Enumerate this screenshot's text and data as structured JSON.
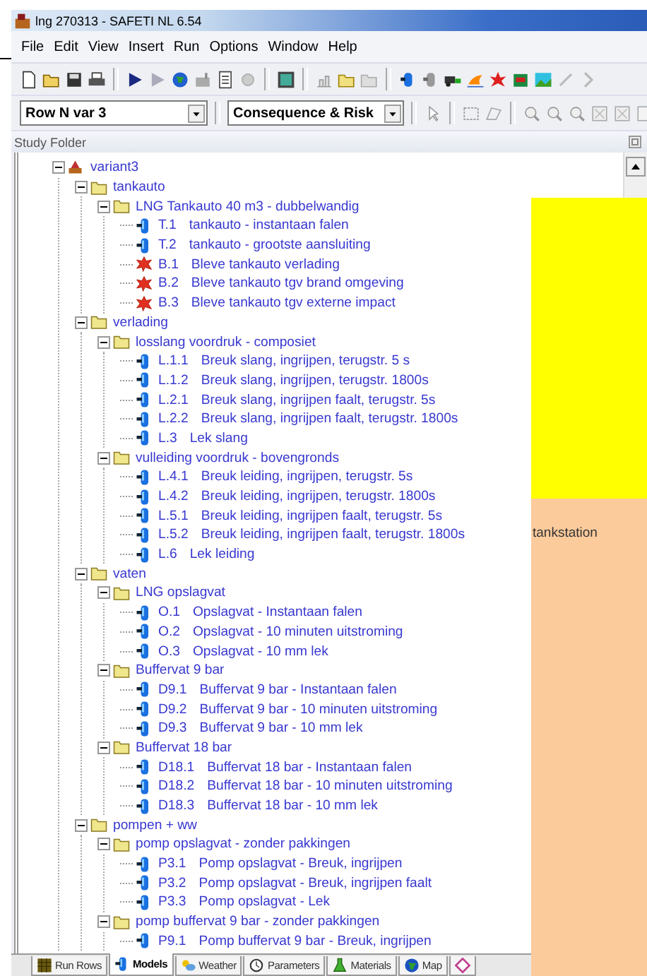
{
  "window": {
    "title": "lng 270313 - SAFETI NL 6.54"
  },
  "menu": [
    "File",
    "Edit",
    "View",
    "Insert",
    "Run",
    "Options",
    "Window",
    "Help"
  ],
  "selectors": [
    {
      "value": "Row N var 3"
    },
    {
      "value": "Consequence & Risk"
    }
  ],
  "panel": {
    "title": "Study Folder"
  },
  "tree": [
    {
      "kind": "study",
      "label": "variant3",
      "expanded": true,
      "children": [
        {
          "kind": "folder",
          "label": "tankauto",
          "expanded": true,
          "children": [
            {
              "kind": "folder",
              "label": "LNG Tankauto 40 m3 - dubbelwandig",
              "expanded": true,
              "children": [
                {
                  "kind": "release",
                  "code": "T.1",
                  "label": "tankauto - instantaan falen"
                },
                {
                  "kind": "release",
                  "code": "T.2",
                  "label": "tankauto - grootste aansluiting"
                },
                {
                  "kind": "bleve",
                  "code": "B.1",
                  "label": "Bleve tankauto verlading"
                },
                {
                  "kind": "bleve",
                  "code": "B.2",
                  "label": "Bleve tankauto tgv brand omgeving"
                },
                {
                  "kind": "bleve",
                  "code": "B.3",
                  "label": "Bleve tankauto tgv externe impact"
                }
              ]
            }
          ]
        },
        {
          "kind": "folder",
          "label": "verlading",
          "expanded": true,
          "children": [
            {
              "kind": "folder",
              "label": "losslang voordruk - composiet",
              "expanded": true,
              "children": [
                {
                  "kind": "release",
                  "code": "L.1.1",
                  "label": "Breuk slang, ingrijpen, terugstr. 5 s"
                },
                {
                  "kind": "release",
                  "code": "L.1.2",
                  "label": "Breuk slang, ingrijpen, terugstr. 1800s"
                },
                {
                  "kind": "release",
                  "code": "L.2.1",
                  "label": "Breuk slang, ingrijpen faalt, terugstr. 5s"
                },
                {
                  "kind": "release",
                  "code": "L.2.2",
                  "label": "Breuk slang, ingrijpen faalt, terugstr. 1800s"
                },
                {
                  "kind": "release",
                  "code": "L.3",
                  "label": "Lek slang"
                }
              ]
            },
            {
              "kind": "folder",
              "label": "vulleiding voordruk - bovengronds",
              "expanded": true,
              "children": [
                {
                  "kind": "release",
                  "code": "L.4.1",
                  "label": "Breuk leiding, ingrijpen, terugstr. 5s"
                },
                {
                  "kind": "release",
                  "code": "L.4.2",
                  "label": "Breuk leiding, ingrijpen, terugstr. 1800s"
                },
                {
                  "kind": "release",
                  "code": "L.5.1",
                  "label": "Breuk leiding, ingrijpen faalt, terugstr. 5s"
                },
                {
                  "kind": "release",
                  "code": "L.5.2",
                  "label": "Breuk leiding, ingrijpen faalt, terugstr. 1800s"
                },
                {
                  "kind": "release",
                  "code": "L.6",
                  "label": "Lek leiding"
                }
              ]
            }
          ]
        },
        {
          "kind": "folder",
          "label": "vaten",
          "expanded": true,
          "children": [
            {
              "kind": "folder",
              "label": "LNG opslagvat",
              "expanded": true,
              "children": [
                {
                  "kind": "release",
                  "code": "O.1",
                  "label": "Opslagvat - Instantaan falen"
                },
                {
                  "kind": "release",
                  "code": "O.2",
                  "label": "Opslagvat - 10 minuten uitstroming"
                },
                {
                  "kind": "release",
                  "code": "O.3",
                  "label": "Opslagvat - 10 mm lek"
                }
              ]
            },
            {
              "kind": "folder",
              "label": "Buffervat 9 bar",
              "expanded": true,
              "children": [
                {
                  "kind": "release",
                  "code": "D9.1",
                  "label": "Buffervat 9 bar - Instantaan falen"
                },
                {
                  "kind": "release",
                  "code": "D9.2",
                  "label": "Buffervat 9 bar - 10 minuten uitstroming"
                },
                {
                  "kind": "release",
                  "code": "D9.3",
                  "label": "Buffervat 9 bar - 10 mm lek"
                }
              ]
            },
            {
              "kind": "folder",
              "label": "Buffervat 18 bar",
              "expanded": true,
              "children": [
                {
                  "kind": "release",
                  "code": "D18.1",
                  "label": "Buffervat 18 bar - Instantaan falen"
                },
                {
                  "kind": "release",
                  "code": "D18.2",
                  "label": "Buffervat 18 bar - 10 minuten uitstroming"
                },
                {
                  "kind": "release",
                  "code": "D18.3",
                  "label": "Buffervat 18 bar - 10 mm lek"
                }
              ]
            }
          ]
        },
        {
          "kind": "folder",
          "label": "pompen + ww",
          "expanded": true,
          "children": [
            {
              "kind": "folder",
              "label": "pomp opslagvat - zonder pakkingen",
              "expanded": true,
              "children": [
                {
                  "kind": "release",
                  "code": "P3.1",
                  "label": "Pomp opslagvat - Breuk, ingrijpen"
                },
                {
                  "kind": "release",
                  "code": "P3.2",
                  "label": "Pomp opslagvat - Breuk, ingrijpen faalt"
                },
                {
                  "kind": "release",
                  "code": "P3.3",
                  "label": "Pomp opslagvat - Lek"
                }
              ]
            },
            {
              "kind": "folder",
              "label": "pomp buffervat 9 bar - zonder pakkingen",
              "expanded": true,
              "children": [
                {
                  "kind": "release",
                  "code": "P9.1",
                  "label": "Pomp buffervat 9 bar - Breuk, ingrijpen"
                }
              ]
            }
          ]
        }
      ]
    }
  ],
  "tabs": [
    {
      "kind": "grid",
      "label": "Run Rows",
      "selected": false
    },
    {
      "kind": "release",
      "label": "Models",
      "selected": true
    },
    {
      "kind": "weather",
      "label": "Weather",
      "selected": false
    },
    {
      "kind": "clock",
      "label": "Parameters",
      "selected": false
    },
    {
      "kind": "flask",
      "label": "Materials",
      "selected": false
    },
    {
      "kind": "globe",
      "label": "Map",
      "selected": false
    },
    {
      "kind": "diamond",
      "selected": false
    }
  ],
  "overlay": [
    {
      "color": "#ffff00"
    },
    {
      "color": "#fccb9c",
      "label": "tankstation"
    }
  ]
}
